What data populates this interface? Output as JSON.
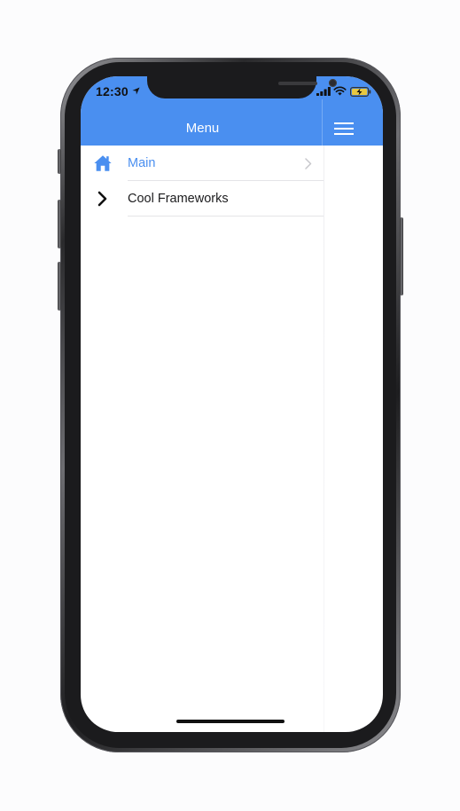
{
  "status_bar": {
    "time": "12:30",
    "location_icon": "location-arrow-icon",
    "signal_icon": "cellular-signal-icon",
    "wifi_icon": "wifi-icon",
    "battery_icon": "battery-charging-icon"
  },
  "nav_bar": {
    "title": "Menu",
    "menu_button_icon": "hamburger-icon"
  },
  "menu": {
    "items": [
      {
        "label": "Main",
        "icon": "home-icon",
        "active": true,
        "disclosure_icon": "chevron-right-icon"
      },
      {
        "label": "Cool Frameworks",
        "icon": "chevron-right-icon",
        "active": false
      }
    ]
  },
  "colors": {
    "accent": "#4a8ff0",
    "header_text": "#ffffff",
    "item_text": "#1c1c1e",
    "separator": "#e4e4e7",
    "disclosure": "#c7c7cc"
  }
}
